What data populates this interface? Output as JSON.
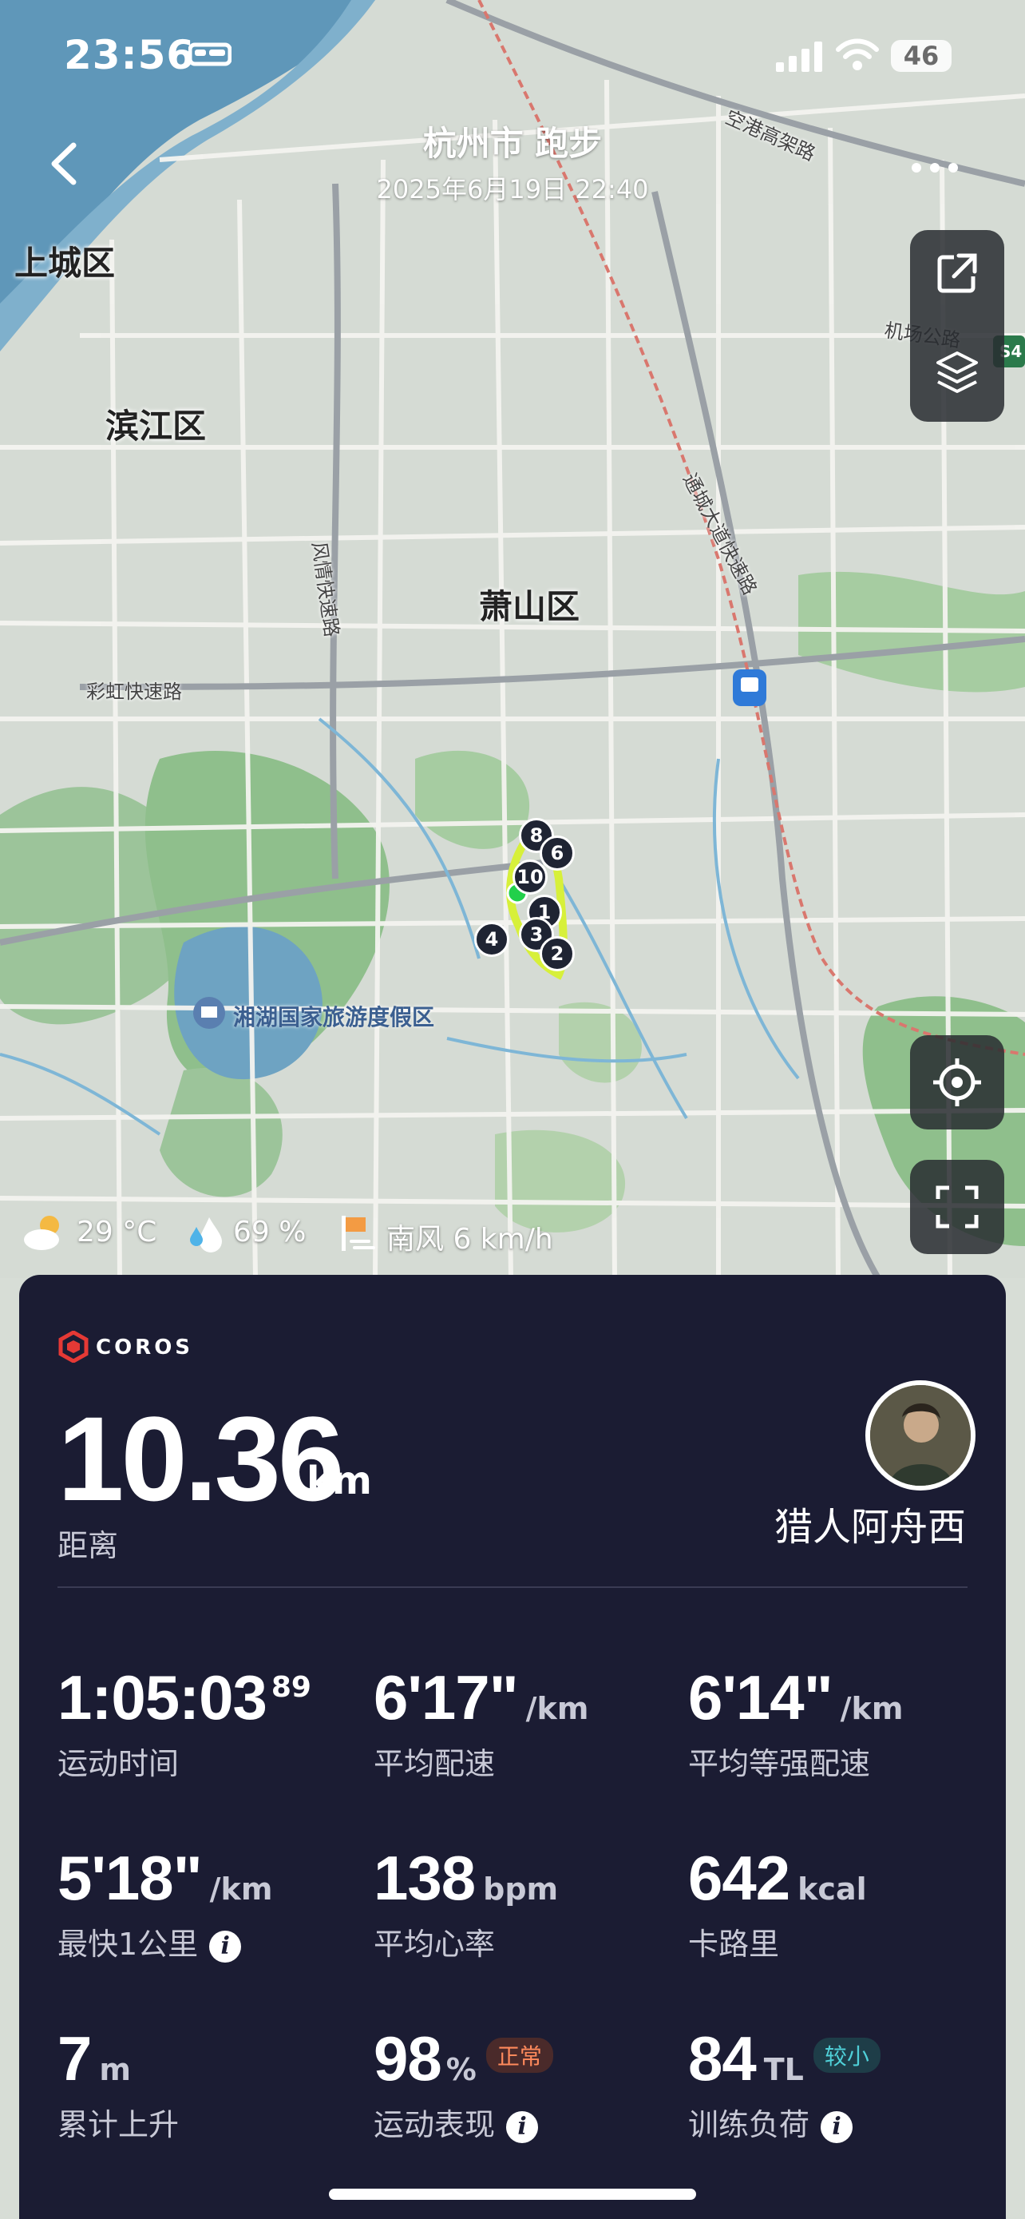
{
  "status_bar": {
    "time": "23:56",
    "battery": "46"
  },
  "header": {
    "title": "杭州市 跑步",
    "subtitle": "2025年6月19日 22:40"
  },
  "map_labels": {
    "district_shangcheng": "上城区",
    "district_binjiang": "滨江区",
    "district_xiaoshan": "萧山区",
    "road_konggang": "空港高架路",
    "road_jichang": "机场公路",
    "road_tongcheng": "通城大道快速路",
    "road_fengqing": "风情快速路",
    "road_caihong": "彩虹快速路",
    "highway_badge": "S4",
    "poi_xianghu": "湘湖国家旅游度假区"
  },
  "route_markers": [
    "10",
    "6",
    "4",
    "3",
    "2",
    "1",
    "8"
  ],
  "weather": {
    "temperature": "29 °C",
    "humidity": "69 %",
    "wind": "南风 6 km/h"
  },
  "brand": "COROS",
  "summary": {
    "distance_value": "10.36",
    "distance_unit": "km",
    "distance_label": "距离",
    "user_name": "猎人阿舟西"
  },
  "stats": {
    "duration": {
      "value": "1:05:03",
      "sup": "89",
      "label": "运动时间"
    },
    "avg_pace": {
      "value": "6'17\"",
      "unit": "/km",
      "label": "平均配速"
    },
    "avg_grade_pace": {
      "value": "6'14\"",
      "unit": "/km",
      "label": "平均等强配速"
    },
    "fastest_km": {
      "value": "5'18\"",
      "unit": "/km",
      "label": "最快1公里"
    },
    "avg_hr": {
      "value": "138",
      "unit": "bpm",
      "label": "平均心率"
    },
    "calories": {
      "value": "642",
      "unit": "kcal",
      "label": "卡路里"
    },
    "ascent": {
      "value": "7",
      "unit": "m",
      "label": "累计上升"
    },
    "performance": {
      "value": "98",
      "unit": "%",
      "badge": "正常",
      "label": "运动表现"
    },
    "training_load": {
      "value": "84",
      "unit": "TL",
      "badge": "较小",
      "label": "训练负荷"
    }
  },
  "colors": {
    "card_bg": "#1b1c33",
    "route": "#d7f03a",
    "start_point": "#22d04a",
    "badge_warn": "#ff8a5c",
    "badge_ok": "#4fd0d8",
    "water": "#5f97b9"
  }
}
